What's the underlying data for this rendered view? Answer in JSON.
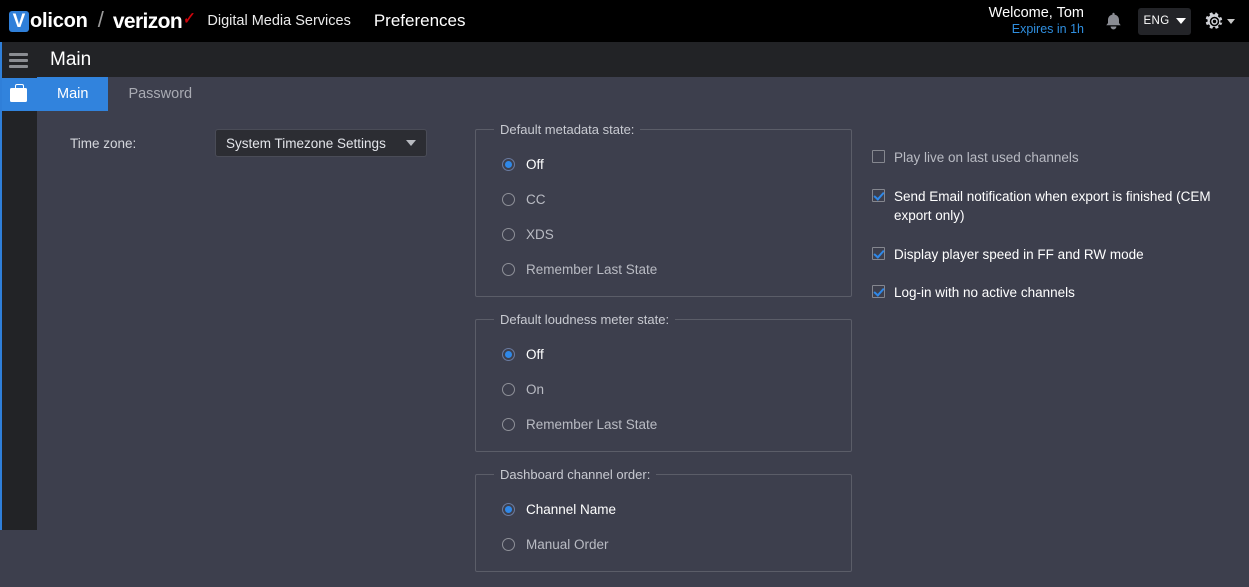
{
  "topbar": {
    "volicon_badge_letter": "V",
    "volicon_word": "olicon",
    "separator": "/",
    "verizon_word": "verizon",
    "verizon_check": "✓",
    "product_name": "Digital Media Services",
    "page_name": "Preferences",
    "welcome_text": "Welcome, Tom",
    "expires_text": "Expires in 1h",
    "language": "ENG",
    "accent_blue": "#2f7fd9",
    "link_blue": "#2f8fe0",
    "verizon_red": "#cd040b"
  },
  "sidebar": {
    "menu_icon": "hamburger-icon",
    "items": [
      {
        "icon": "briefcase-icon",
        "active": true
      }
    ]
  },
  "page": {
    "title": "Main"
  },
  "tabs": [
    {
      "label": "Main",
      "active": true
    },
    {
      "label": "Password",
      "active": false
    }
  ],
  "timezone": {
    "label": "Time zone:",
    "value": "System Timezone Settings",
    "caret": "chevron-down-icon"
  },
  "groups": [
    {
      "legend": "Default metadata state:",
      "options": [
        {
          "label": "Off",
          "checked": true
        },
        {
          "label": "CC",
          "checked": false
        },
        {
          "label": "XDS",
          "checked": false
        },
        {
          "label": "Remember Last State",
          "checked": false
        }
      ]
    },
    {
      "legend": "Default loudness meter state:",
      "options": [
        {
          "label": "Off",
          "checked": true
        },
        {
          "label": "On",
          "checked": false
        },
        {
          "label": "Remember Last State",
          "checked": false
        }
      ]
    },
    {
      "legend": "Dashboard channel order:",
      "options": [
        {
          "label": "Channel Name",
          "checked": true
        },
        {
          "label": "Manual Order",
          "checked": false
        }
      ]
    }
  ],
  "checkboxes": [
    {
      "label": "Play live on last used channels",
      "checked": false
    },
    {
      "label": "Send Email notification when export is finished (CEM export only)",
      "checked": true
    },
    {
      "label": "Display player speed in FF and RW mode",
      "checked": true
    },
    {
      "label": "Log-in with no active channels",
      "checked": true
    }
  ]
}
